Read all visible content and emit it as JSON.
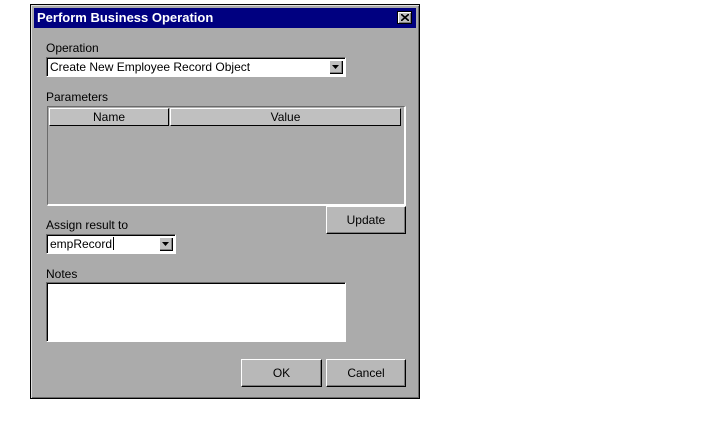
{
  "dialog": {
    "title": "Perform Business Operation",
    "close_icon": "close-x-icon"
  },
  "operation": {
    "label": "Operation",
    "selected": "Create New Employee Record Object"
  },
  "parameters": {
    "label": "Parameters",
    "columns": [
      "Name",
      "Value"
    ],
    "rows": []
  },
  "update_label": "Update",
  "assign": {
    "label": "Assign result to",
    "value": "empRecord"
  },
  "notes": {
    "label": "Notes",
    "value": ""
  },
  "buttons": {
    "ok": "OK",
    "cancel": "Cancel"
  },
  "colors": {
    "title_bar": "#000080",
    "dialog_bg": "#ababab"
  }
}
